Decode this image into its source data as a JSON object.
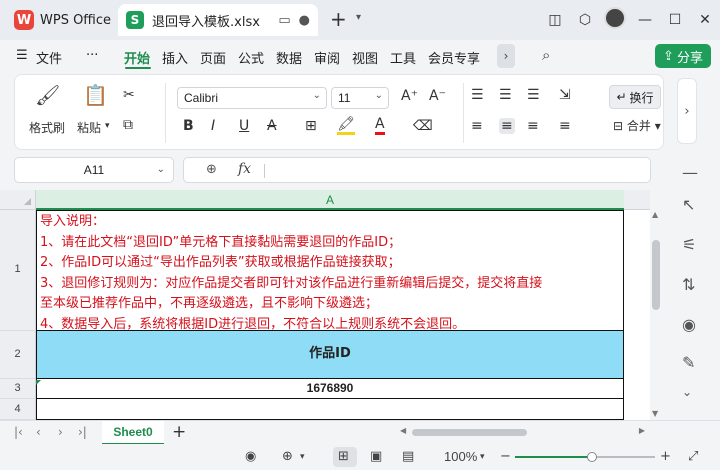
{
  "app": {
    "name": "WPS Office",
    "logo_letter": "W"
  },
  "document_tab": {
    "title": "退回导入模板.xlsx",
    "icon_letter": "S"
  },
  "menu": {
    "items": [
      "文件",
      "开始",
      "插入",
      "页面",
      "公式",
      "数据",
      "审阅",
      "视图",
      "工具",
      "会员专享"
    ],
    "active": "开始",
    "share_label": "分享"
  },
  "ribbon": {
    "format_painter": "格式刷",
    "paste": "粘贴",
    "font_name": "Calibri",
    "font_size": "11",
    "wrap_text": "换行",
    "merge": "合并"
  },
  "formula_bar": {
    "cell_ref": "A11",
    "fx_label": "fx"
  },
  "sheet": {
    "column_header": "A",
    "row_headers": [
      "1",
      "2",
      "3",
      "4"
    ],
    "instructions": [
      "导入说明：",
      "1、请在此文档“退回ID”单元格下直接黏贴需要退回的作品ID；",
      "2、作品ID可以通过“导出作品列表”获取或根据作品链接获取；",
      "3、退回修订规则为：对应作品提交者即可针对该作品进行重新编辑后提交，提交将直接",
      "至本级已推荐作品中，不再逐级遴选，且不影响下级遴选；",
      "4、数据导入后，系统将根据ID进行退回，不符合以上规则系统不会退回。"
    ],
    "header_cell": "作品ID",
    "value_cell": "1676890"
  },
  "sheet_tabs": {
    "active": "Sheet0"
  },
  "status": {
    "zoom": "100%"
  },
  "colors": {
    "accent": "#1f8d4e",
    "instruction_text": "#d6101b",
    "header_fill": "#8fdcf6",
    "wps_red": "#e8453c"
  }
}
